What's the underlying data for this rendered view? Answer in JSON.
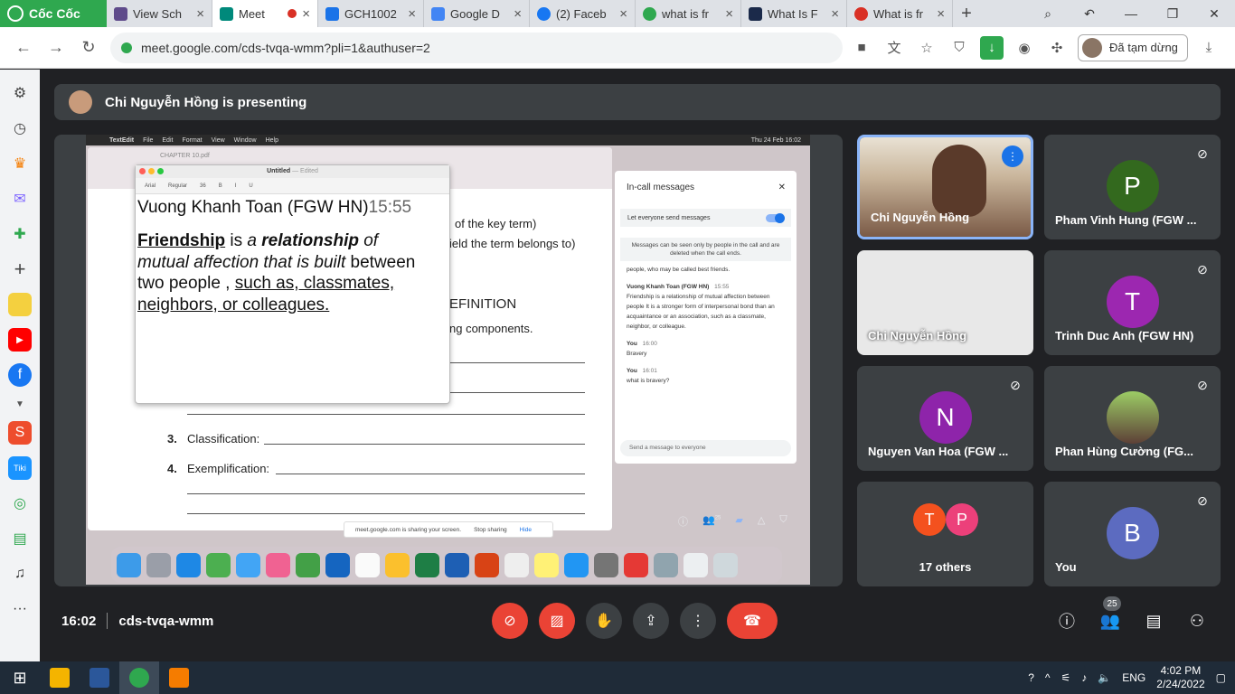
{
  "browser": {
    "brand": "Cốc Cốc",
    "tabs": [
      {
        "title": "View Sch",
        "color": "#5f4b8b",
        "active": false
      },
      {
        "title": "Meet",
        "color": "#00897b",
        "active": true
      },
      {
        "title": "GCH1002",
        "color": "#1a73e8",
        "active": false
      },
      {
        "title": "Google D",
        "color": "#4285f4",
        "active": false
      },
      {
        "title": "(2) Faceb",
        "color": "#1877f2",
        "active": false
      },
      {
        "title": "what is fr",
        "color": "#2fa84f",
        "active": false
      },
      {
        "title": "What Is F",
        "color": "#1b2a4a",
        "active": false
      },
      {
        "title": "What is fr",
        "color": "#d93025",
        "active": false
      }
    ],
    "url": "meet.google.com/cds-tvqa-wmm?pli=1&authuser=2",
    "profile_status": "Đã tạm dừng"
  },
  "presenting_banner": "Chi Nguyễn Hồng is presenting",
  "shared_screen": {
    "menubar": [
      "TextEdit",
      "File",
      "Edit",
      "Format",
      "View",
      "Window",
      "Help"
    ],
    "menubar_clock": "Thu 24 Feb  16:02",
    "pdf_title": "CHAPTER 10.pdf",
    "pdf_lines": [
      "of the key term)",
      "ield the term belongs to)",
      "EFINITION",
      "ng components."
    ],
    "list_items": [
      {
        "num": "3.",
        "label": "Classification:"
      },
      {
        "num": "4.",
        "label": "Exemplification:"
      }
    ],
    "textedit": {
      "title": "Untitled",
      "edited": "— Edited",
      "font": "Arial",
      "style": "Regular",
      "size": "36",
      "author": "Vuong Khanh Toan (FGW HN)",
      "time": "15:55",
      "term": "Friendship",
      "is": " is ",
      "a": "a ",
      "relationship": "relationship",
      "of": " of",
      "mutual": "mutual  affection that is built",
      "between": " between",
      "two_people": "two people , ",
      "examples_1": "such as, classmates,",
      "examples_2": "neighbors, or colleagues."
    },
    "chat": {
      "title": "In-call messages",
      "toggle_label": "Let everyone send messages",
      "note": "Messages can be seen only by people in the call and are deleted when the call ends.",
      "clipped_line": "people, who may be called best friends.",
      "messages": [
        {
          "sender": "Vuong Khanh Toan (FGW HN)",
          "time": "15:55",
          "text": "Friendship is a relationship of mutual affection between people It is a stronger form of interpersonal bond than an acquaintance or an association, such as a classmate, neighbor, or colleague."
        },
        {
          "sender": "You",
          "time": "16:00",
          "text": "Bravery"
        },
        {
          "sender": "You",
          "time": "16:01",
          "text": "what is bravery?"
        }
      ],
      "input_placeholder": "Send a message to everyone",
      "people_count": "25"
    },
    "sharebar": {
      "text": "meet.google.com is sharing your screen.",
      "stop": "Stop sharing",
      "hide": "Hide"
    }
  },
  "participants": [
    {
      "name": "Chi Nguyễn Hồng",
      "kind": "camera",
      "speaking": true
    },
    {
      "name": "Pham Vinh Hung (FGW ...",
      "initial": "P",
      "color": "#33691e",
      "muted": true
    },
    {
      "name": "Chi Nguyễn Hồng",
      "kind": "screen"
    },
    {
      "name": "Trinh Duc Anh (FGW HN)",
      "initial": "T",
      "color": "#9c27b0",
      "muted": true
    },
    {
      "name": "Nguyen Van Hoa (FGW ...",
      "initial": "N",
      "color": "#8e24aa",
      "muted": true
    },
    {
      "name": "Phan Hùng Cường (FG...",
      "kind": "photo",
      "muted": true
    },
    {
      "name": "17 others",
      "kind": "others",
      "initials": [
        "T",
        "P"
      ],
      "colors": [
        "#f4511e",
        "#ec407a"
      ]
    },
    {
      "name": "You",
      "initial": "B",
      "color": "#5c6bc0",
      "muted": true
    }
  ],
  "controls": {
    "time": "16:02",
    "meeting_code": "cds-tvqa-wmm",
    "people_badge": "25"
  },
  "taskbar": {
    "time": "4:02 PM",
    "date": "2/24/2022",
    "lang": "ENG"
  }
}
